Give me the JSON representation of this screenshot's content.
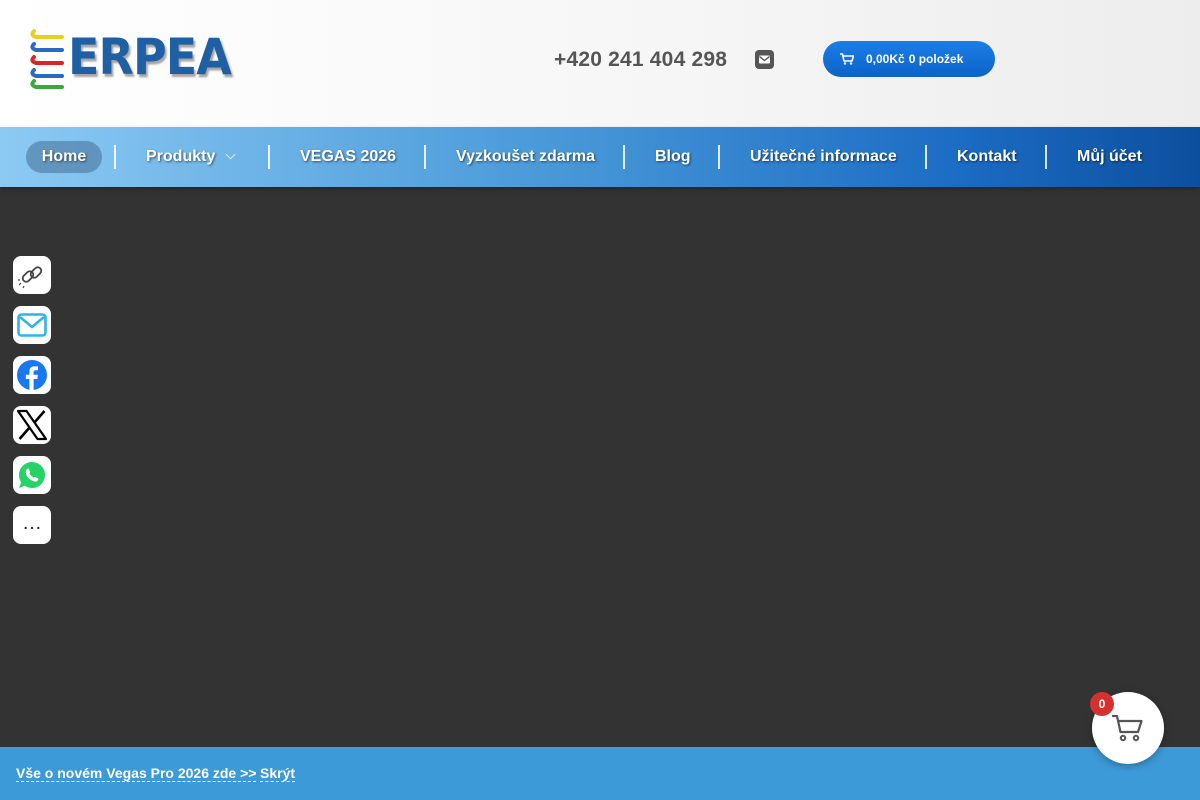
{
  "header": {
    "logo_text": "ERPEA",
    "phone": "+420 241 404 298",
    "mail_icon": "envelope-icon",
    "cart": {
      "amount": "0,00Kč",
      "items": "0 položek",
      "icon": "cart-icon"
    }
  },
  "nav": {
    "items": [
      {
        "label": "Home",
        "active": true
      },
      {
        "label": "Produkty",
        "dropdown": true
      },
      {
        "label": "VEGAS 2026"
      },
      {
        "label": "Vyzkoušet zdarma"
      },
      {
        "label": "Blog"
      },
      {
        "label": "Užitečné informace"
      },
      {
        "label": "Kontakt"
      },
      {
        "label": "Můj účet"
      }
    ]
  },
  "share": {
    "items": [
      {
        "icon": "copy-link-icon"
      },
      {
        "icon": "email-icon"
      },
      {
        "icon": "facebook-icon"
      },
      {
        "icon": "x-icon"
      },
      {
        "icon": "whatsapp-icon"
      },
      {
        "icon": "more-icon",
        "label": "…"
      }
    ]
  },
  "banner": {
    "link": "Vše o novém Vegas Pro 2026 zde >>",
    "hide": "Skrýt"
  },
  "floating_cart": {
    "count": "0"
  },
  "colors": {
    "nav_start": "#8ccaf3",
    "nav_end": "#0d4f9e",
    "cart_button": "#1a7ee8",
    "banner": "#3d9ad8",
    "badge": "#d63030",
    "content_bg": "#333333"
  }
}
